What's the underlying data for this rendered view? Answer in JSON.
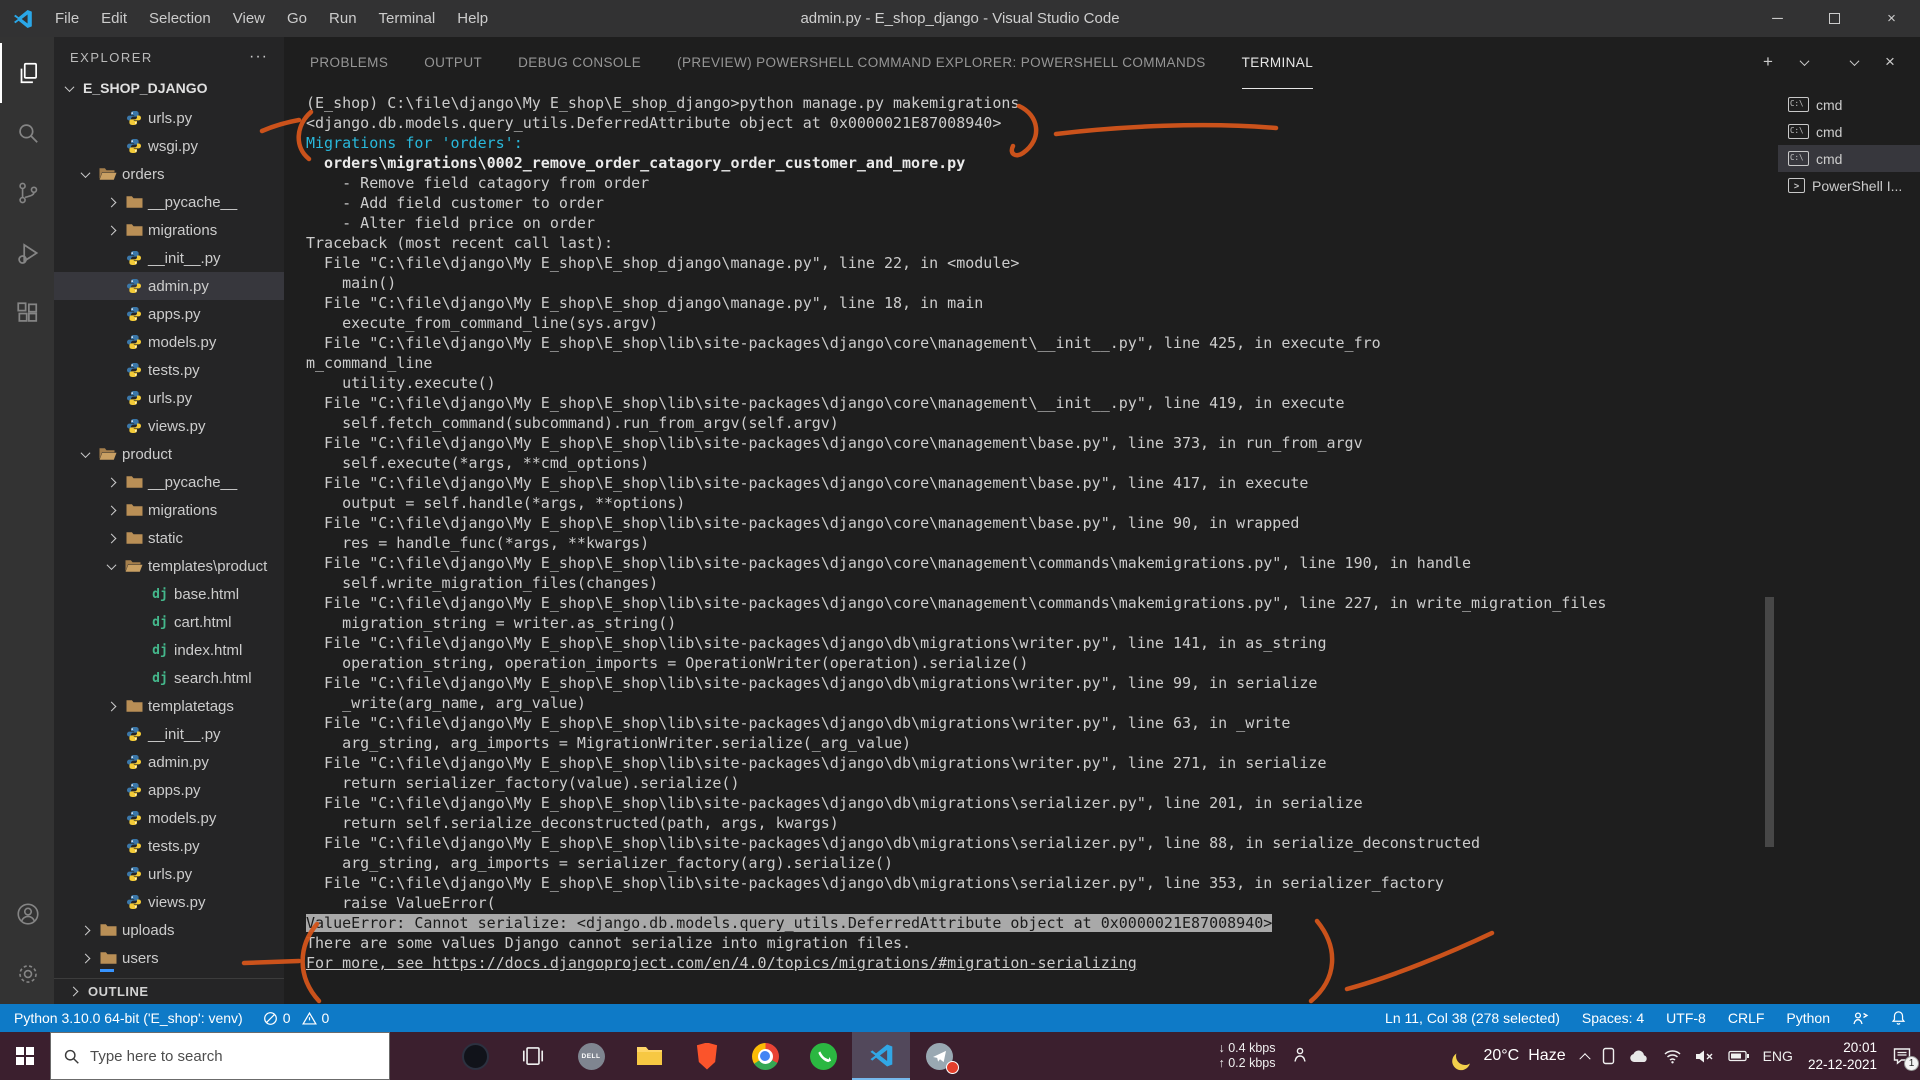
{
  "window": {
    "title": "admin.py - E_shop_django - Visual Studio Code",
    "menu": [
      "File",
      "Edit",
      "Selection",
      "View",
      "Go",
      "Run",
      "Terminal",
      "Help"
    ]
  },
  "activity_bar": {
    "icons": [
      "explorer",
      "search",
      "source-control",
      "run-debug",
      "extensions"
    ],
    "bottom_icons": [
      "account",
      "settings"
    ]
  },
  "explorer": {
    "header": "EXPLORER",
    "actions": "···",
    "section": "E_SHOP_DJANGO",
    "outline": "OUTLINE",
    "tree": [
      {
        "label": "urls.py",
        "icon": "py",
        "level": 2
      },
      {
        "label": "wsgi.py",
        "icon": "py",
        "level": 2
      },
      {
        "label": "orders",
        "icon": "folder-open",
        "level": 1,
        "chev": "down"
      },
      {
        "label": "__pycache__",
        "icon": "folder",
        "level": 2,
        "chev": "right"
      },
      {
        "label": "migrations",
        "icon": "folder",
        "level": 2,
        "chev": "right"
      },
      {
        "label": "__init__.py",
        "icon": "py",
        "level": 2
      },
      {
        "label": "admin.py",
        "icon": "py",
        "level": 2,
        "selected": true
      },
      {
        "label": "apps.py",
        "icon": "py",
        "level": 2
      },
      {
        "label": "models.py",
        "icon": "py",
        "level": 2
      },
      {
        "label": "tests.py",
        "icon": "py",
        "level": 2
      },
      {
        "label": "urls.py",
        "icon": "py",
        "level": 2
      },
      {
        "label": "views.py",
        "icon": "py",
        "level": 2
      },
      {
        "label": "product",
        "icon": "folder-open",
        "level": 1,
        "chev": "down"
      },
      {
        "label": "__pycache__",
        "icon": "folder",
        "level": 2,
        "chev": "right"
      },
      {
        "label": "migrations",
        "icon": "folder",
        "level": 2,
        "chev": "right"
      },
      {
        "label": "static",
        "icon": "folder",
        "level": 2,
        "chev": "right"
      },
      {
        "label": "templates\\product",
        "icon": "folder-open",
        "level": 2,
        "chev": "down"
      },
      {
        "label": "base.html",
        "icon": "dj",
        "level": 3
      },
      {
        "label": "cart.html",
        "icon": "dj",
        "level": 3
      },
      {
        "label": "index.html",
        "icon": "dj",
        "level": 3
      },
      {
        "label": "search.html",
        "icon": "dj",
        "level": 3
      },
      {
        "label": "templatetags",
        "icon": "folder",
        "level": 2,
        "chev": "right"
      },
      {
        "label": "__init__.py",
        "icon": "py",
        "level": 2
      },
      {
        "label": "admin.py",
        "icon": "py",
        "level": 2
      },
      {
        "label": "apps.py",
        "icon": "py",
        "level": 2
      },
      {
        "label": "models.py",
        "icon": "py",
        "level": 2
      },
      {
        "label": "tests.py",
        "icon": "py",
        "level": 2
      },
      {
        "label": "urls.py",
        "icon": "py",
        "level": 2
      },
      {
        "label": "views.py",
        "icon": "py",
        "level": 2
      },
      {
        "label": "uploads",
        "icon": "folder",
        "level": 1,
        "chev": "right"
      },
      {
        "label": "users",
        "icon": "folder",
        "level": 1,
        "chev": "right"
      }
    ]
  },
  "panel": {
    "tabs": [
      {
        "label": "PROBLEMS",
        "active": false
      },
      {
        "label": "OUTPUT",
        "active": false
      },
      {
        "label": "DEBUG CONSOLE",
        "active": false
      },
      {
        "label": "(PREVIEW) POWERSHELL COMMAND EXPLORER: POWERSHELL COMMANDS",
        "active": false
      },
      {
        "label": "TERMINAL",
        "active": true
      }
    ],
    "actions": [
      "new-terminal",
      "launch-profile-dropdown",
      "panel-chevron",
      "close-panel"
    ]
  },
  "terminal": {
    "lines": [
      {
        "t": "(E_shop) C:\\file\\django\\My E_shop\\E_shop_django>python manage.py makemigrations"
      },
      {
        "t": "<django.db.models.query_utils.DeferredAttribute object at 0x0000021E87008940>"
      },
      {
        "t": "Migrations for 'orders':",
        "s": "cyan"
      },
      {
        "t": "  orders\\migrations\\0002_remove_order_catagory_order_customer_and_more.py",
        "s": "bold"
      },
      {
        "t": "    - Remove field catagory from order"
      },
      {
        "t": "    - Add field customer to order"
      },
      {
        "t": "    - Alter field price on order"
      },
      {
        "t": "Traceback (most recent call last):"
      },
      {
        "t": "  File \"C:\\file\\django\\My E_shop\\E_shop_django\\manage.py\", line 22, in <module>"
      },
      {
        "t": "    main()"
      },
      {
        "t": "  File \"C:\\file\\django\\My E_shop\\E_shop_django\\manage.py\", line 18, in main"
      },
      {
        "t": "    execute_from_command_line(sys.argv)"
      },
      {
        "t": "  File \"C:\\file\\django\\My E_shop\\E_shop\\lib\\site-packages\\django\\core\\management\\__init__.py\", line 425, in execute_fro"
      },
      {
        "t": "m_command_line"
      },
      {
        "t": "    utility.execute()"
      },
      {
        "t": "  File \"C:\\file\\django\\My E_shop\\E_shop\\lib\\site-packages\\django\\core\\management\\__init__.py\", line 419, in execute"
      },
      {
        "t": "    self.fetch_command(subcommand).run_from_argv(self.argv)"
      },
      {
        "t": "  File \"C:\\file\\django\\My E_shop\\E_shop\\lib\\site-packages\\django\\core\\management\\base.py\", line 373, in run_from_argv"
      },
      {
        "t": "    self.execute(*args, **cmd_options)"
      },
      {
        "t": "  File \"C:\\file\\django\\My E_shop\\E_shop\\lib\\site-packages\\django\\core\\management\\base.py\", line 417, in execute"
      },
      {
        "t": "    output = self.handle(*args, **options)"
      },
      {
        "t": "  File \"C:\\file\\django\\My E_shop\\E_shop\\lib\\site-packages\\django\\core\\management\\base.py\", line 90, in wrapped"
      },
      {
        "t": "    res = handle_func(*args, **kwargs)"
      },
      {
        "t": "  File \"C:\\file\\django\\My E_shop\\E_shop\\lib\\site-packages\\django\\core\\management\\commands\\makemigrations.py\", line 190, in handle"
      },
      {
        "t": "    self.write_migration_files(changes)"
      },
      {
        "t": "  File \"C:\\file\\django\\My E_shop\\E_shop\\lib\\site-packages\\django\\core\\management\\commands\\makemigrations.py\", line 227, in write_migration_files"
      },
      {
        "t": "    migration_string = writer.as_string()"
      },
      {
        "t": "  File \"C:\\file\\django\\My E_shop\\E_shop\\lib\\site-packages\\django\\db\\migrations\\writer.py\", line 141, in as_string"
      },
      {
        "t": "    operation_string, operation_imports = OperationWriter(operation).serialize()"
      },
      {
        "t": "  File \"C:\\file\\django\\My E_shop\\E_shop\\lib\\site-packages\\django\\db\\migrations\\writer.py\", line 99, in serialize"
      },
      {
        "t": "    _write(arg_name, arg_value)"
      },
      {
        "t": "  File \"C:\\file\\django\\My E_shop\\E_shop\\lib\\site-packages\\django\\db\\migrations\\writer.py\", line 63, in _write"
      },
      {
        "t": "    arg_string, arg_imports = MigrationWriter.serialize(_arg_value)"
      },
      {
        "t": "  File \"C:\\file\\django\\My E_shop\\E_shop\\lib\\site-packages\\django\\db\\migrations\\writer.py\", line 271, in serialize"
      },
      {
        "t": "    return serializer_factory(value).serialize()"
      },
      {
        "t": "  File \"C:\\file\\django\\My E_shop\\E_shop\\lib\\site-packages\\django\\db\\migrations\\serializer.py\", line 201, in serialize"
      },
      {
        "t": "    return self.serialize_deconstructed(path, args, kwargs)"
      },
      {
        "t": "  File \"C:\\file\\django\\My E_shop\\E_shop\\lib\\site-packages\\django\\db\\migrations\\serializer.py\", line 88, in serialize_deconstructed"
      },
      {
        "t": "    arg_string, arg_imports = serializer_factory(arg).serialize()"
      },
      {
        "t": "  File \"C:\\file\\django\\My E_shop\\E_shop\\lib\\site-packages\\django\\db\\migrations\\serializer.py\", line 353, in serializer_factory"
      },
      {
        "t": "    raise ValueError("
      },
      {
        "t": "ValueError: Cannot serialize: <django.db.models.query_utils.DeferredAttribute object at 0x0000021E87008940>",
        "s": "hl"
      },
      {
        "t": "There are some values Django cannot serialize into migration files."
      },
      {
        "t": "For more, see https://docs.djangoproject.com/en/4.0/topics/migrations/#migration-serializing",
        "s": "link"
      }
    ]
  },
  "terminal_list": [
    {
      "label": "cmd",
      "icon": "cmd",
      "selected": false
    },
    {
      "label": "cmd",
      "icon": "cmd",
      "selected": false
    },
    {
      "label": "cmd",
      "icon": "cmd",
      "selected": true
    },
    {
      "label": "PowerShell I...",
      "icon": "powershell",
      "selected": false
    }
  ],
  "status_bar": {
    "python_version": "Python 3.10.0 64-bit ('E_shop': venv)",
    "errors": "0",
    "warnings": "0",
    "cursor": "Ln 11, Col 38 (278 selected)",
    "spaces": "Spaces: 4",
    "encoding": "UTF-8",
    "eol": "CRLF",
    "language": "Python"
  },
  "taskbar": {
    "search_placeholder": "Type here to search",
    "app_icons": [
      "round-app",
      "task-view",
      "dell",
      "file-explorer",
      "brave",
      "chrome",
      "whatsapp",
      "vscode",
      "telegram"
    ],
    "net_down": "0.4 kbps",
    "net_up": "0.2 kbps",
    "weather_temp": "20°C",
    "weather_desc": "Haze",
    "tray_icons": [
      "chevron-up",
      "phone",
      "onedrive-cloud",
      "wifi",
      "volume-muted",
      "battery"
    ],
    "language": "ENG",
    "time": "20:01",
    "date": "22-12-2021",
    "notification_count": "1"
  },
  "colors": {
    "status_bar": "#0e7ac7",
    "taskbar": "#3b1f2e",
    "terminal_cyan": "#29b8db",
    "annotation": "#d4551b",
    "selection_highlight": "#a9a9a9"
  }
}
